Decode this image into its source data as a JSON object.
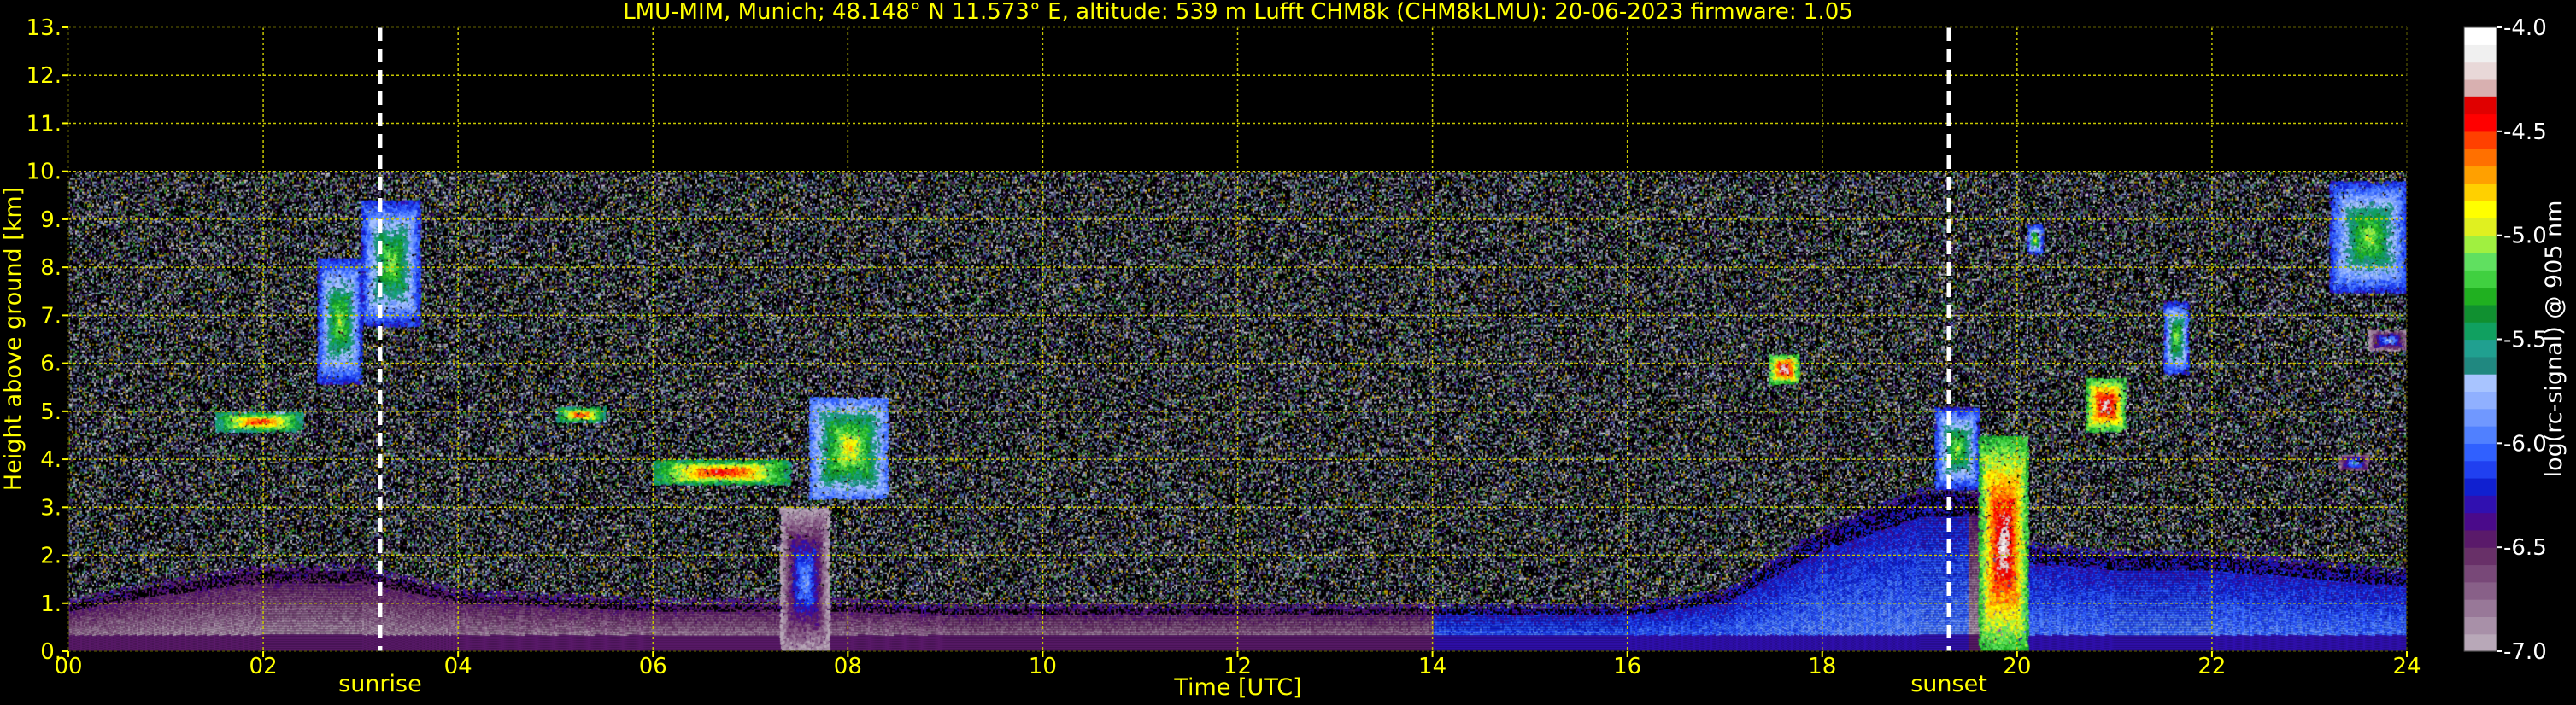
{
  "chart_data": {
    "type": "heatmap",
    "title": "LMU-MIM, Munich; 48.148° N 11.573° E, altitude: 539 m    Lufft CHM8k (CHM8kLMU): 20-06-2023    firmware: 1.05",
    "xlabel": "Time [UTC]",
    "ylabel": "Height above ground [km]",
    "xlim": [
      0,
      24
    ],
    "ylim": [
      0,
      13
    ],
    "data_top_km": 10,
    "x_ticks": [
      0,
      2,
      4,
      6,
      8,
      10,
      12,
      14,
      16,
      18,
      20,
      22,
      24
    ],
    "x_tick_labels": [
      "00",
      "02",
      "04",
      "06",
      "08",
      "10",
      "12",
      "14",
      "16",
      "18",
      "20",
      "22",
      "24"
    ],
    "y_ticks": [
      0,
      1,
      2,
      3,
      4,
      5,
      6,
      7,
      8,
      9,
      10,
      11,
      12,
      13
    ],
    "y_tick_labels": [
      "0.",
      "1.",
      "2.",
      "3.",
      "4.",
      "5.",
      "6.",
      "7.",
      "8.",
      "9.",
      "10.",
      "11.",
      "12.",
      "13."
    ],
    "grid": true,
    "grid_color": "#c8c800",
    "events": [
      {
        "name": "sunrise",
        "time": 3.2
      },
      {
        "name": "sunset",
        "time": 19.3
      }
    ],
    "colorbar": {
      "label": "log(rc-signal) @ 905 nm",
      "range": [
        -7.0,
        -4.0
      ],
      "ticks": [
        -7.0,
        -6.5,
        -6.0,
        -5.5,
        -5.0,
        -4.5,
        -4.0
      ],
      "tick_labels": [
        "-7.0",
        "-6.5",
        "-6.0",
        "-5.5",
        "-5.0",
        "-4.5",
        "-4.0"
      ],
      "colors": [
        "#b8a8b8",
        "#a890a8",
        "#987898",
        "#886088",
        "#784878",
        "#683068",
        "#5a1a6a",
        "#4a0a8a",
        "#3010b0",
        "#1020d0",
        "#2040f0",
        "#3060ff",
        "#5080ff",
        "#7098ff",
        "#90b0ff",
        "#a8c4ff",
        "#208880",
        "#20a090",
        "#10a060",
        "#109030",
        "#20b020",
        "#40d040",
        "#60e060",
        "#a0f040",
        "#e0f020",
        "#ffff00",
        "#ffd000",
        "#ffa000",
        "#ff7000",
        "#ff4000",
        "#ff0000",
        "#e00000",
        "#d8b0b0",
        "#e8d8d8",
        "#f0f0f0",
        "#ffffff"
      ]
    },
    "features": [
      {
        "type": "mixed_layer",
        "x": [
          0,
          1,
          2,
          3,
          4,
          5,
          6,
          7,
          8,
          9,
          10,
          11,
          12,
          13,
          14,
          15,
          16,
          17,
          18,
          19,
          19.7,
          20,
          21,
          22,
          23,
          24
        ],
        "top_km": [
          1.0,
          1.4,
          1.7,
          1.7,
          1.2,
          1.1,
          1.0,
          1.0,
          1.0,
          0.9,
          0.9,
          0.9,
          0.9,
          0.9,
          0.9,
          0.9,
          0.9,
          1.2,
          2.5,
          3.3,
          3.3,
          2.2,
          2.0,
          2.0,
          1.8,
          1.6
        ]
      },
      {
        "type": "cloud",
        "x": [
          2.55,
          3.0
        ],
        "base_km": 5.6,
        "top_km": 8.2,
        "intensity": -5.0
      },
      {
        "type": "cloud",
        "x": [
          3.0,
          3.6
        ],
        "base_km": 6.8,
        "top_km": 9.4,
        "intensity": -5.0
      },
      {
        "type": "cloud",
        "x": [
          1.5,
          2.4
        ],
        "base_km": 4.6,
        "top_km": 5.0,
        "intensity": -4.4
      },
      {
        "type": "cloud",
        "x": [
          5.0,
          5.5
        ],
        "base_km": 4.8,
        "top_km": 5.1,
        "intensity": -4.4
      },
      {
        "type": "cloud",
        "x": [
          6.0,
          7.4
        ],
        "base_km": 3.5,
        "top_km": 4.0,
        "intensity": -4.3
      },
      {
        "type": "cloud",
        "x": [
          7.6,
          8.4
        ],
        "base_km": 3.2,
        "top_km": 5.3,
        "intensity": -4.8
      },
      {
        "type": "fallstreak",
        "x": [
          7.3,
          7.8
        ],
        "base_km": 0.0,
        "top_km": 3.0,
        "intensity": -5.8
      },
      {
        "type": "cloud",
        "x": [
          17.45,
          17.75
        ],
        "base_km": 5.6,
        "top_km": 6.2,
        "intensity": -4.1
      },
      {
        "type": "cloud",
        "x": [
          19.15,
          19.6
        ],
        "base_km": 3.4,
        "top_km": 5.1,
        "intensity": -5.0
      },
      {
        "type": "fallstreak",
        "x": [
          19.6,
          20.1
        ],
        "base_km": 0.0,
        "top_km": 4.5,
        "intensity": -4.1
      },
      {
        "type": "cloud",
        "x": [
          20.1,
          20.25
        ],
        "base_km": 8.3,
        "top_km": 8.9,
        "intensity": -5.0
      },
      {
        "type": "cloud",
        "x": [
          20.7,
          21.1
        ],
        "base_km": 4.6,
        "top_km": 5.7,
        "intensity": -4.1
      },
      {
        "type": "cloud",
        "x": [
          21.5,
          21.75
        ],
        "base_km": 5.8,
        "top_km": 7.3,
        "intensity": -5.0
      },
      {
        "type": "cloud",
        "x": [
          23.2,
          24.0
        ],
        "base_km": 7.5,
        "top_km": 9.8,
        "intensity": -5.0
      },
      {
        "type": "cloud",
        "x": [
          23.3,
          23.6
        ],
        "base_km": 3.8,
        "top_km": 4.1,
        "intensity": -5.6
      },
      {
        "type": "cloud",
        "x": [
          23.6,
          24.0
        ],
        "base_km": 6.3,
        "top_km": 6.7,
        "intensity": -5.7
      }
    ]
  }
}
